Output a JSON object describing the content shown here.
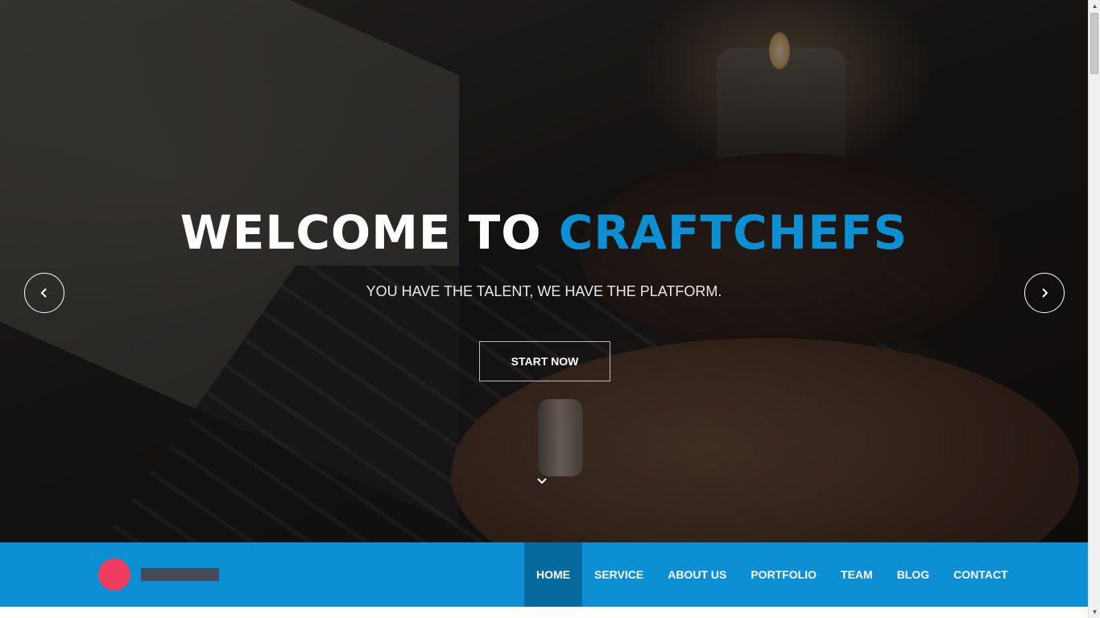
{
  "hero": {
    "title_white": "WELCOME TO ",
    "title_accent": "CRAFTCHEFS",
    "subtitle": "YOU HAVE THE TALENT, WE HAVE THE PLATFORM.",
    "cta_label": "START NOW",
    "prev_icon": "chevron-left-icon",
    "next_icon": "chevron-right-icon",
    "scroll_icon": "chevron-down-icon"
  },
  "nav": {
    "items": [
      {
        "label": "HOME",
        "active": true
      },
      {
        "label": "SERVICE",
        "active": false
      },
      {
        "label": "ABOUT US",
        "active": false
      },
      {
        "label": "PORTFOLIO",
        "active": false
      },
      {
        "label": "TEAM",
        "active": false
      },
      {
        "label": "BLOG",
        "active": false
      },
      {
        "label": "CONTACT",
        "active": false
      }
    ]
  },
  "colors": {
    "accent": "#0d8fd4",
    "nav_active": "#076a9e",
    "logo_circle": "#ef3d5f",
    "logo_bar": "#444a5a"
  },
  "scrollbar": {
    "position_fraction": 0.0
  }
}
